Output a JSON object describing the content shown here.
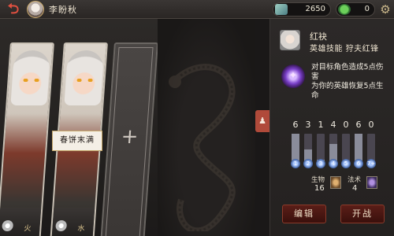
{
  "header": {
    "hero_name": "李盼秋",
    "back_icon": "back-arrow-icon",
    "currency_gem": "2650",
    "currency_leaf": "0",
    "settings_icon": "gear-icon"
  },
  "cards": [
    {
      "element_label": "火"
    },
    {
      "element_label": "水"
    }
  ],
  "card_name_banner": "春饼末满",
  "skill": {
    "name": "红袂",
    "subtitle": "英雄技能  狩夫红锋",
    "description": "对目标角色造成5点伤害\n为你的英雄恢复5点生命"
  },
  "mana_curve": {
    "counts": [
      "6",
      "3",
      "1",
      "4",
      "0",
      "6",
      "0"
    ],
    "costs": [
      "1",
      "2",
      "3",
      "4",
      "5",
      "6",
      "7+"
    ]
  },
  "stats": {
    "creature_label": "生物",
    "creature_count": "16",
    "spell_label": "法术",
    "spell_count": "4"
  },
  "buttons": {
    "edit": "编辑",
    "fight": "开战"
  },
  "colors": {
    "accent_red": "#b04a3a",
    "panel_dark": "#2c2928"
  }
}
